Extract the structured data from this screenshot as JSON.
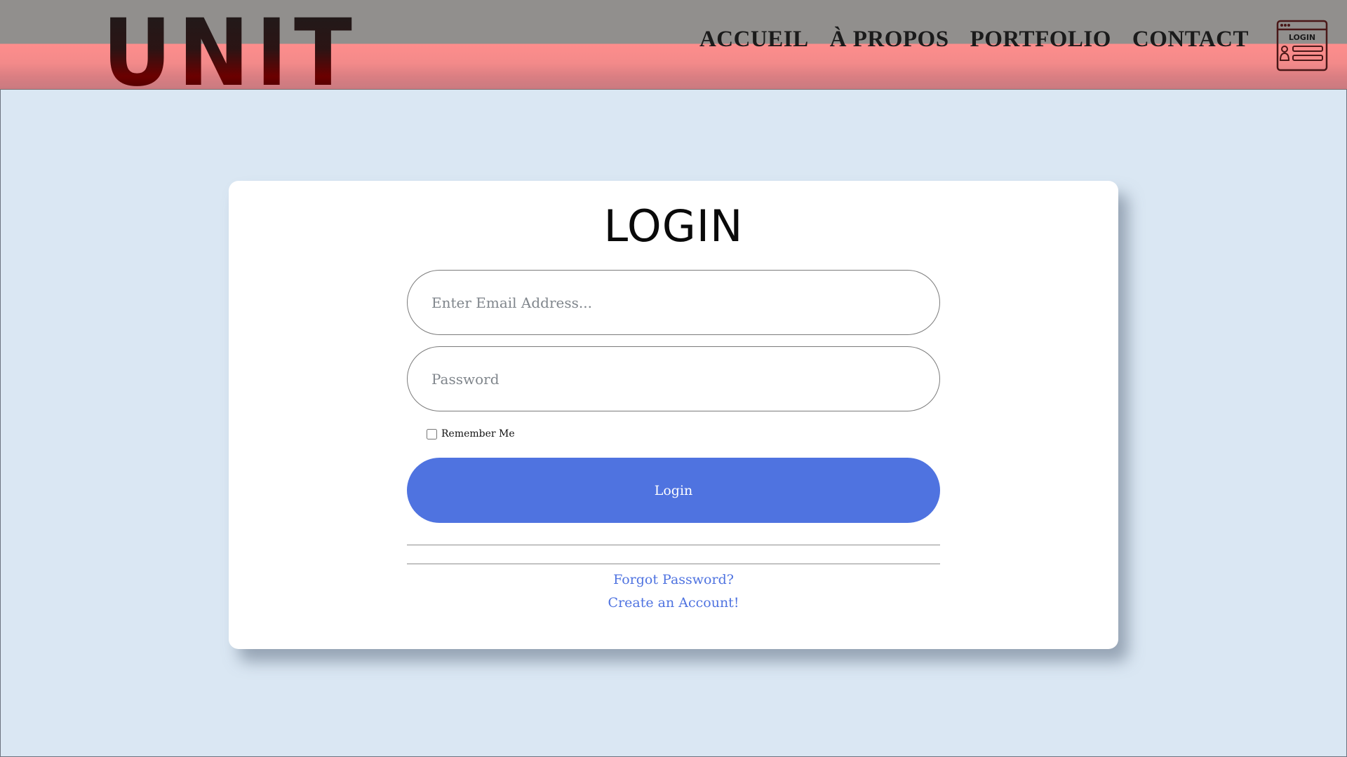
{
  "header": {
    "logo": "UNIT",
    "nav": [
      "ACCUEIL",
      "À PROPOS",
      "PORTFOLIO",
      "CONTACT"
    ],
    "login_icon_label": "LOGIN",
    "login_icon": "login-window-icon"
  },
  "card": {
    "title": "LOGIN",
    "email_placeholder": "Enter Email Address...",
    "password_placeholder": "Password",
    "remember_label": "Remember Me",
    "remember_checked": false,
    "login_button": "Login",
    "forgot_link": "Forgot Password?",
    "create_link": "Create an Account!"
  },
  "colors": {
    "page_background": "#dae7f3",
    "header_top": "#918f8d",
    "header_bottom": "#fe8d8c",
    "primary": "#4f73e0",
    "logo_dark_red": "#6b0000"
  }
}
